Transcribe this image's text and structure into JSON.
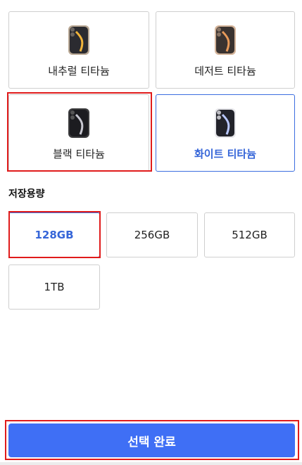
{
  "colors": {
    "natural": "#cbb9a6",
    "desert": "#d7b59c",
    "black": "#3b3b3d",
    "white": "#efeff1",
    "accent": "#3f6ff5",
    "highlight": "#e01b1b"
  },
  "color_options": [
    {
      "label": "내추럴 티타늄",
      "icon": "phone-natural-icon"
    },
    {
      "label": "데저트 티타늄",
      "icon": "phone-desert-icon"
    },
    {
      "label": "블랙 티타늄",
      "icon": "phone-black-icon"
    },
    {
      "label": "화이트 티타늄",
      "icon": "phone-white-icon"
    }
  ],
  "storage": {
    "title": "저장용량",
    "options": [
      {
        "label": "128GB"
      },
      {
        "label": "256GB"
      },
      {
        "label": "512GB"
      },
      {
        "label": "1TB"
      }
    ]
  },
  "confirm_button": {
    "label": "선택 완료"
  }
}
